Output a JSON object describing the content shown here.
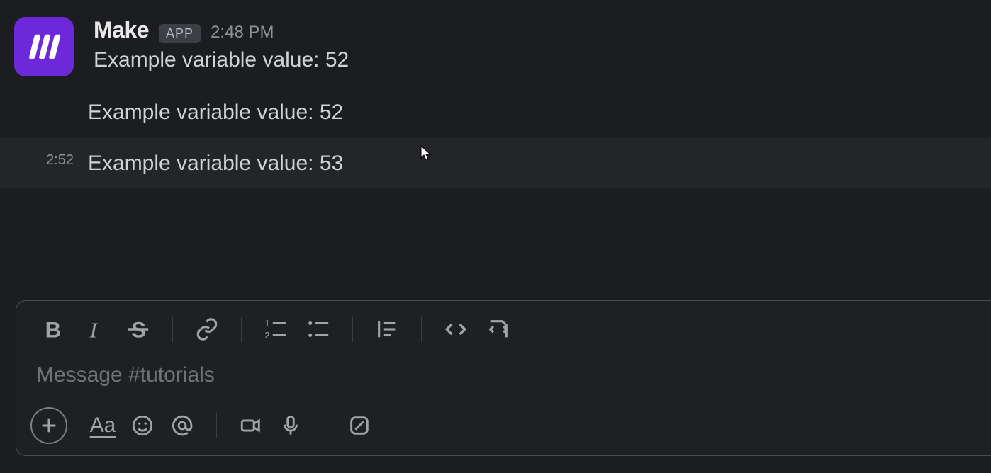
{
  "sender": {
    "name": "Make",
    "badge": "APP",
    "avatar_icon": "make-logo"
  },
  "messages": [
    {
      "time": "2:48 PM",
      "text": "Example variable value: 52",
      "first": true
    },
    {
      "time": "",
      "text": "Example variable value: 52",
      "first": false
    },
    {
      "time": "2:52",
      "text": "Example variable value: 53",
      "first": false,
      "hovered": true
    }
  ],
  "composer": {
    "placeholder": "Message #tutorials"
  },
  "toolbar_top": {
    "bold": "B",
    "italic": "I",
    "strike": "S",
    "link": "link",
    "ol": "ol",
    "ul": "ul",
    "quote": "quote",
    "code": "code",
    "codeblock": "codeblock"
  },
  "toolbar_bottom": {
    "plus": "+",
    "format": "Aa",
    "emoji": "emoji",
    "mention": "@",
    "video": "video",
    "mic": "mic",
    "shortcut": "shortcut"
  },
  "colors": {
    "bg": "#1b1d21",
    "avatar_bg": "#6d28d9",
    "divider": "#9b3b39"
  }
}
